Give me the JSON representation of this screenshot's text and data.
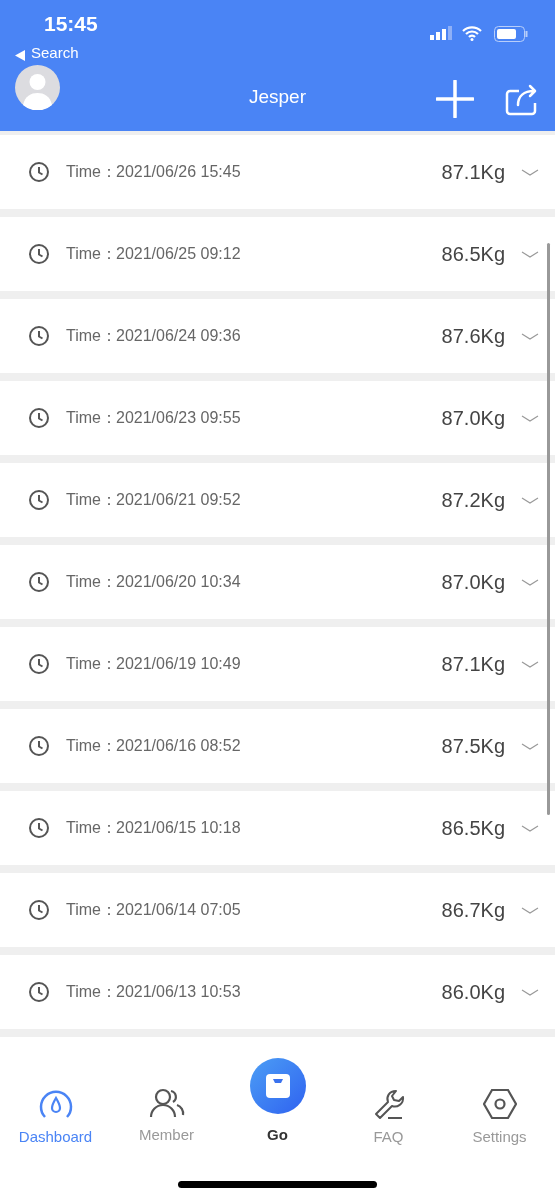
{
  "status_bar": {
    "time": "15:45",
    "back": "Search"
  },
  "header": {
    "title": "Jesper"
  },
  "records": [
    {
      "label": "Time：",
      "time": "2021/06/26 15:45",
      "weight": "87.1Kg",
      "expanded": false
    },
    {
      "label": "Time：",
      "time": "2021/06/25 09:12",
      "weight": "86.5Kg",
      "expanded": false
    },
    {
      "label": "Time：",
      "time": "2021/06/24 09:36",
      "weight": "87.6Kg",
      "expanded": false
    },
    {
      "label": "Time：",
      "time": "2021/06/23 09:55",
      "weight": "87.0Kg",
      "expanded": false
    },
    {
      "label": "Time：",
      "time": "2021/06/21 09:52",
      "weight": "87.2Kg",
      "expanded": false
    },
    {
      "label": "Time：",
      "time": "2021/06/20 10:34",
      "weight": "87.0Kg",
      "expanded": false
    },
    {
      "label": "Time：",
      "time": "2021/06/19 10:49",
      "weight": "87.1Kg",
      "expanded": false
    },
    {
      "label": "Time：",
      "time": "2021/06/16 08:52",
      "weight": "87.5Kg",
      "expanded": false
    },
    {
      "label": "Time：",
      "time": "2021/06/15 10:18",
      "weight": "86.5Kg",
      "expanded": false
    },
    {
      "label": "Time：",
      "time": "2021/06/14 07:05",
      "weight": "86.7Kg",
      "expanded": false
    },
    {
      "label": "Time：",
      "time": "2021/06/13 10:53",
      "weight": "86.0Kg",
      "expanded": false
    }
  ],
  "tabs": [
    {
      "kind": "gauge",
      "label": "Dashboard",
      "selected": true
    },
    {
      "kind": "people",
      "label": "Member",
      "selected": false
    },
    {
      "kind": "go",
      "label": "Go",
      "selected": false
    },
    {
      "kind": "wrench",
      "label": "FAQ",
      "selected": false
    },
    {
      "kind": "hex",
      "label": "Settings",
      "selected": false
    }
  ]
}
